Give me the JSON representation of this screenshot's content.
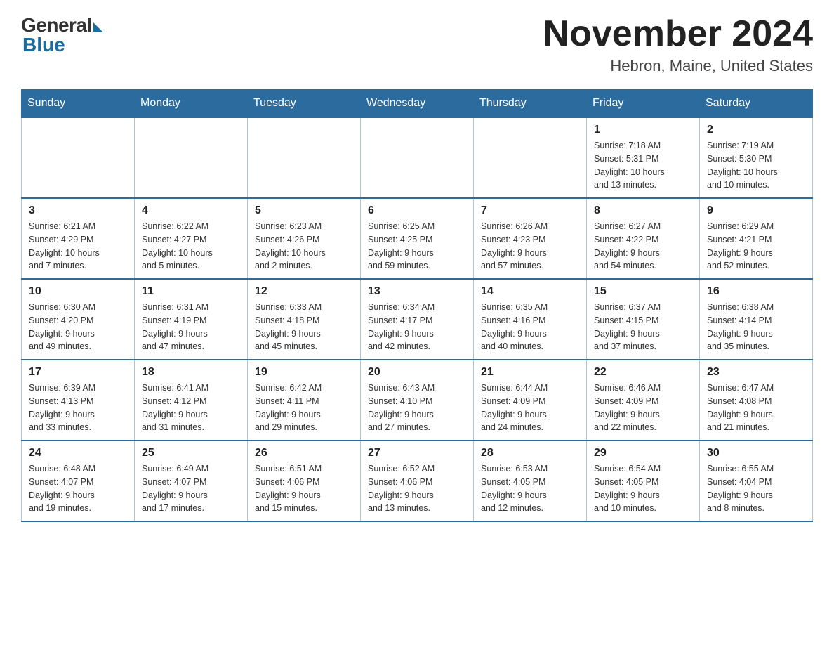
{
  "header": {
    "logo_general": "General",
    "logo_blue": "Blue",
    "month_title": "November 2024",
    "location": "Hebron, Maine, United States"
  },
  "weekdays": [
    "Sunday",
    "Monday",
    "Tuesday",
    "Wednesday",
    "Thursday",
    "Friday",
    "Saturday"
  ],
  "weeks": [
    [
      {
        "day": "",
        "info": ""
      },
      {
        "day": "",
        "info": ""
      },
      {
        "day": "",
        "info": ""
      },
      {
        "day": "",
        "info": ""
      },
      {
        "day": "",
        "info": ""
      },
      {
        "day": "1",
        "info": "Sunrise: 7:18 AM\nSunset: 5:31 PM\nDaylight: 10 hours\nand 13 minutes."
      },
      {
        "day": "2",
        "info": "Sunrise: 7:19 AM\nSunset: 5:30 PM\nDaylight: 10 hours\nand 10 minutes."
      }
    ],
    [
      {
        "day": "3",
        "info": "Sunrise: 6:21 AM\nSunset: 4:29 PM\nDaylight: 10 hours\nand 7 minutes."
      },
      {
        "day": "4",
        "info": "Sunrise: 6:22 AM\nSunset: 4:27 PM\nDaylight: 10 hours\nand 5 minutes."
      },
      {
        "day": "5",
        "info": "Sunrise: 6:23 AM\nSunset: 4:26 PM\nDaylight: 10 hours\nand 2 minutes."
      },
      {
        "day": "6",
        "info": "Sunrise: 6:25 AM\nSunset: 4:25 PM\nDaylight: 9 hours\nand 59 minutes."
      },
      {
        "day": "7",
        "info": "Sunrise: 6:26 AM\nSunset: 4:23 PM\nDaylight: 9 hours\nand 57 minutes."
      },
      {
        "day": "8",
        "info": "Sunrise: 6:27 AM\nSunset: 4:22 PM\nDaylight: 9 hours\nand 54 minutes."
      },
      {
        "day": "9",
        "info": "Sunrise: 6:29 AM\nSunset: 4:21 PM\nDaylight: 9 hours\nand 52 minutes."
      }
    ],
    [
      {
        "day": "10",
        "info": "Sunrise: 6:30 AM\nSunset: 4:20 PM\nDaylight: 9 hours\nand 49 minutes."
      },
      {
        "day": "11",
        "info": "Sunrise: 6:31 AM\nSunset: 4:19 PM\nDaylight: 9 hours\nand 47 minutes."
      },
      {
        "day": "12",
        "info": "Sunrise: 6:33 AM\nSunset: 4:18 PM\nDaylight: 9 hours\nand 45 minutes."
      },
      {
        "day": "13",
        "info": "Sunrise: 6:34 AM\nSunset: 4:17 PM\nDaylight: 9 hours\nand 42 minutes."
      },
      {
        "day": "14",
        "info": "Sunrise: 6:35 AM\nSunset: 4:16 PM\nDaylight: 9 hours\nand 40 minutes."
      },
      {
        "day": "15",
        "info": "Sunrise: 6:37 AM\nSunset: 4:15 PM\nDaylight: 9 hours\nand 37 minutes."
      },
      {
        "day": "16",
        "info": "Sunrise: 6:38 AM\nSunset: 4:14 PM\nDaylight: 9 hours\nand 35 minutes."
      }
    ],
    [
      {
        "day": "17",
        "info": "Sunrise: 6:39 AM\nSunset: 4:13 PM\nDaylight: 9 hours\nand 33 minutes."
      },
      {
        "day": "18",
        "info": "Sunrise: 6:41 AM\nSunset: 4:12 PM\nDaylight: 9 hours\nand 31 minutes."
      },
      {
        "day": "19",
        "info": "Sunrise: 6:42 AM\nSunset: 4:11 PM\nDaylight: 9 hours\nand 29 minutes."
      },
      {
        "day": "20",
        "info": "Sunrise: 6:43 AM\nSunset: 4:10 PM\nDaylight: 9 hours\nand 27 minutes."
      },
      {
        "day": "21",
        "info": "Sunrise: 6:44 AM\nSunset: 4:09 PM\nDaylight: 9 hours\nand 24 minutes."
      },
      {
        "day": "22",
        "info": "Sunrise: 6:46 AM\nSunset: 4:09 PM\nDaylight: 9 hours\nand 22 minutes."
      },
      {
        "day": "23",
        "info": "Sunrise: 6:47 AM\nSunset: 4:08 PM\nDaylight: 9 hours\nand 21 minutes."
      }
    ],
    [
      {
        "day": "24",
        "info": "Sunrise: 6:48 AM\nSunset: 4:07 PM\nDaylight: 9 hours\nand 19 minutes."
      },
      {
        "day": "25",
        "info": "Sunrise: 6:49 AM\nSunset: 4:07 PM\nDaylight: 9 hours\nand 17 minutes."
      },
      {
        "day": "26",
        "info": "Sunrise: 6:51 AM\nSunset: 4:06 PM\nDaylight: 9 hours\nand 15 minutes."
      },
      {
        "day": "27",
        "info": "Sunrise: 6:52 AM\nSunset: 4:06 PM\nDaylight: 9 hours\nand 13 minutes."
      },
      {
        "day": "28",
        "info": "Sunrise: 6:53 AM\nSunset: 4:05 PM\nDaylight: 9 hours\nand 12 minutes."
      },
      {
        "day": "29",
        "info": "Sunrise: 6:54 AM\nSunset: 4:05 PM\nDaylight: 9 hours\nand 10 minutes."
      },
      {
        "day": "30",
        "info": "Sunrise: 6:55 AM\nSunset: 4:04 PM\nDaylight: 9 hours\nand 8 minutes."
      }
    ]
  ]
}
